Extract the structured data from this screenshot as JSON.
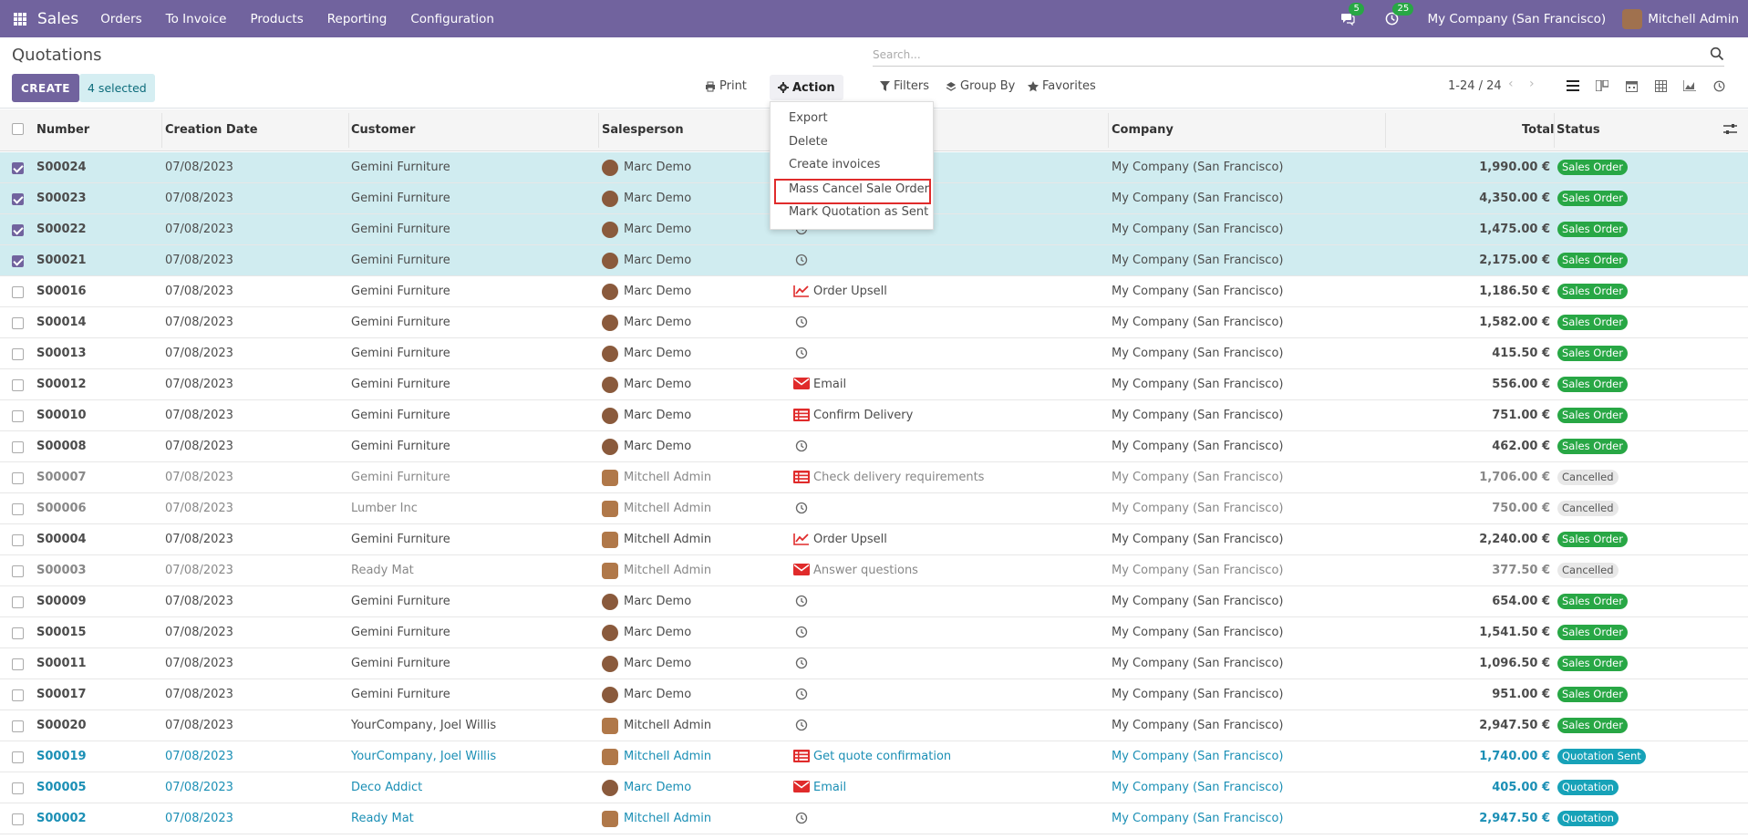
{
  "navbar": {
    "brand": "Sales",
    "menu": [
      "Orders",
      "To Invoice",
      "Products",
      "Reporting",
      "Configuration"
    ],
    "messages_count": "5",
    "activities_count": "25",
    "company": "My Company (San Francisco)",
    "user": "Mitchell Admin",
    "color": "#71639e"
  },
  "control_panel": {
    "title": "Quotations",
    "create_label": "CREATE",
    "selected_label": "4 selected",
    "print_label": "Print",
    "action_label": "Action",
    "search_placeholder": "Search...",
    "filters_label": "Filters",
    "groupby_label": "Group By",
    "favorites_label": "Favorites",
    "pager": "1-24 / 24"
  },
  "action_menu": {
    "items": [
      "Export",
      "Delete",
      "Create invoices",
      "Mass Cancel Sale Order",
      "Mark Quotation as Sent"
    ],
    "highlighted": "Mass Cancel Sale Order"
  },
  "table": {
    "headers": [
      "Number",
      "Creation Date",
      "Customer",
      "Salesperson",
      "Company",
      "Total",
      "Status"
    ],
    "rows": [
      {
        "number": "S00024",
        "date": "07/08/2023",
        "customer": "Gemini Furniture",
        "salesperson": "Marc Demo",
        "activity": "",
        "activity_icon": "none",
        "company": "My Company (San Francisco)",
        "total": "1,990.00 €",
        "status": "Sales Order",
        "selected": true,
        "style": "so"
      },
      {
        "number": "S00023",
        "date": "07/08/2023",
        "customer": "Gemini Furniture",
        "salesperson": "Marc Demo",
        "activity": "",
        "activity_icon": "none",
        "company": "My Company (San Francisco)",
        "total": "4,350.00 €",
        "status": "Sales Order",
        "selected": true,
        "style": "so"
      },
      {
        "number": "S00022",
        "date": "07/08/2023",
        "customer": "Gemini Furniture",
        "salesperson": "Marc Demo",
        "activity": "",
        "activity_icon": "clock",
        "company": "My Company (San Francisco)",
        "total": "1,475.00 €",
        "status": "Sales Order",
        "selected": true,
        "style": "so"
      },
      {
        "number": "S00021",
        "date": "07/08/2023",
        "customer": "Gemini Furniture",
        "salesperson": "Marc Demo",
        "activity": "",
        "activity_icon": "clock",
        "company": "My Company (San Francisco)",
        "total": "2,175.00 €",
        "status": "Sales Order",
        "selected": true,
        "style": "so"
      },
      {
        "number": "S00016",
        "date": "07/08/2023",
        "customer": "Gemini Furniture",
        "salesperson": "Marc Demo",
        "activity": "Order Upsell",
        "activity_icon": "chart",
        "company": "My Company (San Francisco)",
        "total": "1,186.50 €",
        "status": "Sales Order",
        "selected": false,
        "style": "so"
      },
      {
        "number": "S00014",
        "date": "07/08/2023",
        "customer": "Gemini Furniture",
        "salesperson": "Marc Demo",
        "activity": "",
        "activity_icon": "clock",
        "company": "My Company (San Francisco)",
        "total": "1,582.00 €",
        "status": "Sales Order",
        "selected": false,
        "style": "so"
      },
      {
        "number": "S00013",
        "date": "07/08/2023",
        "customer": "Gemini Furniture",
        "salesperson": "Marc Demo",
        "activity": "",
        "activity_icon": "clock",
        "company": "My Company (San Francisco)",
        "total": "415.50 €",
        "status": "Sales Order",
        "selected": false,
        "style": "so"
      },
      {
        "number": "S00012",
        "date": "07/08/2023",
        "customer": "Gemini Furniture",
        "salesperson": "Marc Demo",
        "activity": "Email",
        "activity_icon": "envelope",
        "company": "My Company (San Francisco)",
        "total": "556.00 €",
        "status": "Sales Order",
        "selected": false,
        "style": "so"
      },
      {
        "number": "S00010",
        "date": "07/08/2023",
        "customer": "Gemini Furniture",
        "salesperson": "Marc Demo",
        "activity": "Confirm Delivery",
        "activity_icon": "tasks",
        "company": "My Company (San Francisco)",
        "total": "751.00 €",
        "status": "Sales Order",
        "selected": false,
        "style": "so"
      },
      {
        "number": "S00008",
        "date": "07/08/2023",
        "customer": "Gemini Furniture",
        "salesperson": "Marc Demo",
        "activity": "",
        "activity_icon": "clock",
        "company": "My Company (San Francisco)",
        "total": "462.00 €",
        "status": "Sales Order",
        "selected": false,
        "style": "so"
      },
      {
        "number": "S00007",
        "date": "07/08/2023",
        "customer": "Gemini Furniture",
        "salesperson": "Mitchell Admin",
        "activity": "Check delivery requirements",
        "activity_icon": "tasks",
        "company": "My Company (San Francisco)",
        "total": "1,706.00 €",
        "status": "Cancelled",
        "selected": false,
        "style": "cancel"
      },
      {
        "number": "S00006",
        "date": "07/08/2023",
        "customer": "Lumber Inc",
        "salesperson": "Mitchell Admin",
        "activity": "",
        "activity_icon": "clock",
        "company": "My Company (San Francisco)",
        "total": "750.00 €",
        "status": "Cancelled",
        "selected": false,
        "style": "cancel"
      },
      {
        "number": "S00004",
        "date": "07/08/2023",
        "customer": "Gemini Furniture",
        "salesperson": "Mitchell Admin",
        "activity": "Order Upsell",
        "activity_icon": "chart",
        "company": "My Company (San Francisco)",
        "total": "2,240.00 €",
        "status": "Sales Order",
        "selected": false,
        "style": "so"
      },
      {
        "number": "S00003",
        "date": "07/08/2023",
        "customer": "Ready Mat",
        "salesperson": "Mitchell Admin",
        "activity": "Answer questions",
        "activity_icon": "envelope",
        "company": "My Company (San Francisco)",
        "total": "377.50 €",
        "status": "Cancelled",
        "selected": false,
        "style": "cancel"
      },
      {
        "number": "S00009",
        "date": "07/08/2023",
        "customer": "Gemini Furniture",
        "salesperson": "Marc Demo",
        "activity": "",
        "activity_icon": "clock",
        "company": "My Company (San Francisco)",
        "total": "654.00 €",
        "status": "Sales Order",
        "selected": false,
        "style": "so"
      },
      {
        "number": "S00015",
        "date": "07/08/2023",
        "customer": "Gemini Furniture",
        "salesperson": "Marc Demo",
        "activity": "",
        "activity_icon": "clock",
        "company": "My Company (San Francisco)",
        "total": "1,541.50 €",
        "status": "Sales Order",
        "selected": false,
        "style": "so"
      },
      {
        "number": "S00011",
        "date": "07/08/2023",
        "customer": "Gemini Furniture",
        "salesperson": "Marc Demo",
        "activity": "",
        "activity_icon": "clock",
        "company": "My Company (San Francisco)",
        "total": "1,096.50 €",
        "status": "Sales Order",
        "selected": false,
        "style": "so"
      },
      {
        "number": "S00017",
        "date": "07/08/2023",
        "customer": "Gemini Furniture",
        "salesperson": "Marc Demo",
        "activity": "",
        "activity_icon": "clock",
        "company": "My Company (San Francisco)",
        "total": "951.00 €",
        "status": "Sales Order",
        "selected": false,
        "style": "so"
      },
      {
        "number": "S00020",
        "date": "07/08/2023",
        "customer": "YourCompany, Joel Willis",
        "salesperson": "Mitchell Admin",
        "activity": "",
        "activity_icon": "clock",
        "company": "My Company (San Francisco)",
        "total": "2,947.50 €",
        "status": "Sales Order",
        "selected": false,
        "style": "so"
      },
      {
        "number": "S00019",
        "date": "07/08/2023",
        "customer": "YourCompany, Joel Willis",
        "salesperson": "Mitchell Admin",
        "activity": "Get quote confirmation",
        "activity_icon": "tasks",
        "company": "My Company (San Francisco)",
        "total": "1,740.00 €",
        "status": "Quotation Sent",
        "selected": false,
        "style": "sent"
      },
      {
        "number": "S00005",
        "date": "07/08/2023",
        "customer": "Deco Addict",
        "salesperson": "Marc Demo",
        "activity": "Email",
        "activity_icon": "envelope",
        "company": "My Company (San Francisco)",
        "total": "405.00 €",
        "status": "Quotation",
        "selected": false,
        "style": "quote"
      },
      {
        "number": "S00002",
        "date": "07/08/2023",
        "customer": "Ready Mat",
        "salesperson": "Mitchell Admin",
        "activity": "",
        "activity_icon": "clock",
        "company": "My Company (San Francisco)",
        "total": "2,947.50 €",
        "status": "Quotation",
        "selected": false,
        "style": "quote"
      }
    ]
  }
}
